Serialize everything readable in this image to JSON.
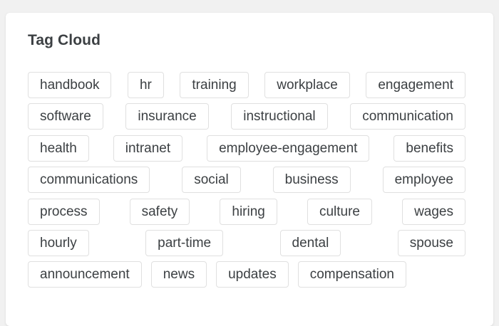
{
  "card": {
    "title": "Tag Cloud"
  },
  "tag_rows": [
    [
      "handbook",
      "hr",
      "training",
      "workplace",
      "engagement"
    ],
    [
      "software",
      "insurance",
      "instructional",
      "communication"
    ],
    [
      "health",
      "intranet",
      "employee-engagement",
      "benefits"
    ],
    [
      "communications",
      "social",
      "business",
      "employee"
    ],
    [
      "process",
      "safety",
      "hiring",
      "culture",
      "wages"
    ],
    [
      "hourly",
      "part-time",
      "dental",
      "spouse"
    ],
    [
      "announcement",
      "news",
      "updates",
      "compensation"
    ]
  ],
  "colors": {
    "page_background": "#f1f1f1",
    "card_background": "#ffffff",
    "text": "#3c4043",
    "tag_border": "#e0e0e0"
  }
}
